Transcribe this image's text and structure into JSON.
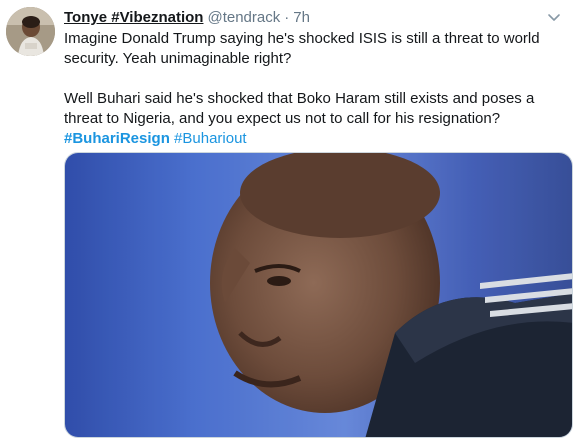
{
  "tweet": {
    "display_name": "Tonye #Vibeznation",
    "handle": "@tendrack",
    "separator": "·",
    "time": "7h",
    "text_line1": "Imagine Donald Trump saying he's shocked ISIS is still a threat to world security. Yeah unimaginable right?",
    "text_line2": "Well Buhari said he's shocked that Boko Haram still exists and poses a threat to Nigeria, and you expect us not to call for his resignation?",
    "hashtags": [
      "#BuhariResign",
      "#Buhariout"
    ]
  },
  "icons": {
    "more": "chevron-down-icon"
  },
  "colors": {
    "link": "#1b95e0",
    "text": "#14171a",
    "muted": "#657786"
  }
}
